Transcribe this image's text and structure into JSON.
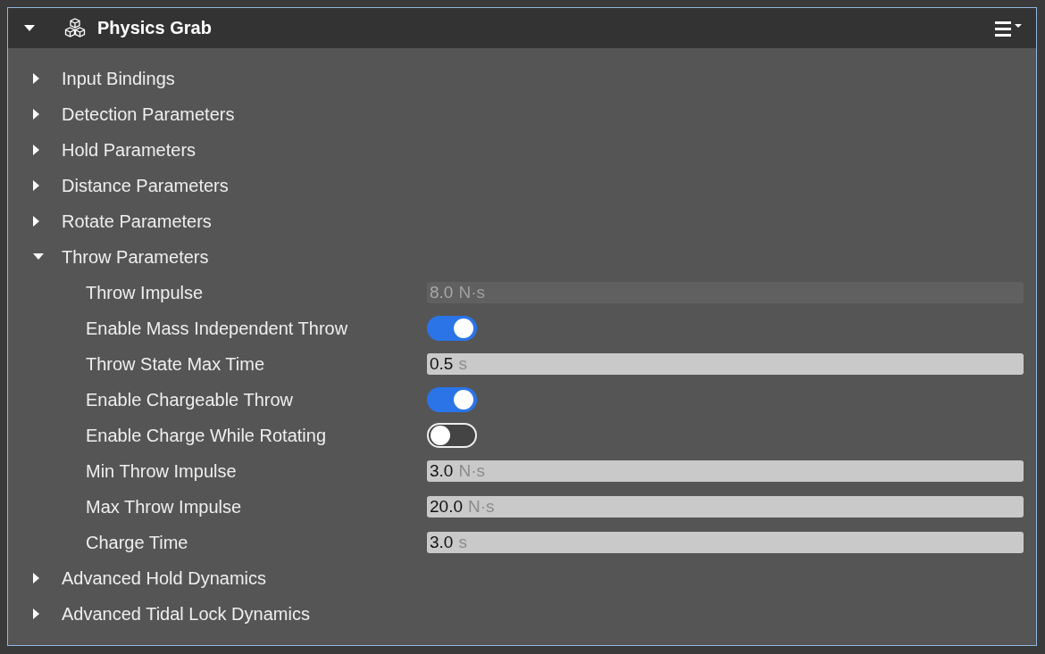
{
  "component": {
    "title": "Physics Grab",
    "expanded": true
  },
  "groups": [
    {
      "label": "Input Bindings",
      "expanded": false
    },
    {
      "label": "Detection Parameters",
      "expanded": false
    },
    {
      "label": "Hold Parameters",
      "expanded": false
    },
    {
      "label": "Distance Parameters",
      "expanded": false
    },
    {
      "label": "Rotate Parameters",
      "expanded": false
    },
    {
      "label": "Throw Parameters",
      "expanded": true,
      "properties": [
        {
          "kind": "number",
          "label": "Throw Impulse",
          "value": "8.0",
          "unit": "N·s",
          "disabled": true
        },
        {
          "kind": "toggle",
          "label": "Enable Mass Independent Throw",
          "on": true
        },
        {
          "kind": "number",
          "label": "Throw State Max Time",
          "value": "0.5",
          "unit": "s",
          "disabled": false
        },
        {
          "kind": "toggle",
          "label": "Enable Chargeable Throw",
          "on": true
        },
        {
          "kind": "toggle",
          "label": "Enable Charge While Rotating",
          "on": false
        },
        {
          "kind": "number",
          "label": "Min Throw Impulse",
          "value": "3.0",
          "unit": "N·s",
          "disabled": false
        },
        {
          "kind": "number",
          "label": "Max Throw Impulse",
          "value": "20.0",
          "unit": "N·s",
          "disabled": false
        },
        {
          "kind": "number",
          "label": "Charge Time",
          "value": "3.0",
          "unit": "s",
          "disabled": false
        }
      ]
    },
    {
      "label": "Advanced Hold Dynamics",
      "expanded": false
    },
    {
      "label": "Advanced Tidal Lock Dynamics",
      "expanded": false
    }
  ]
}
